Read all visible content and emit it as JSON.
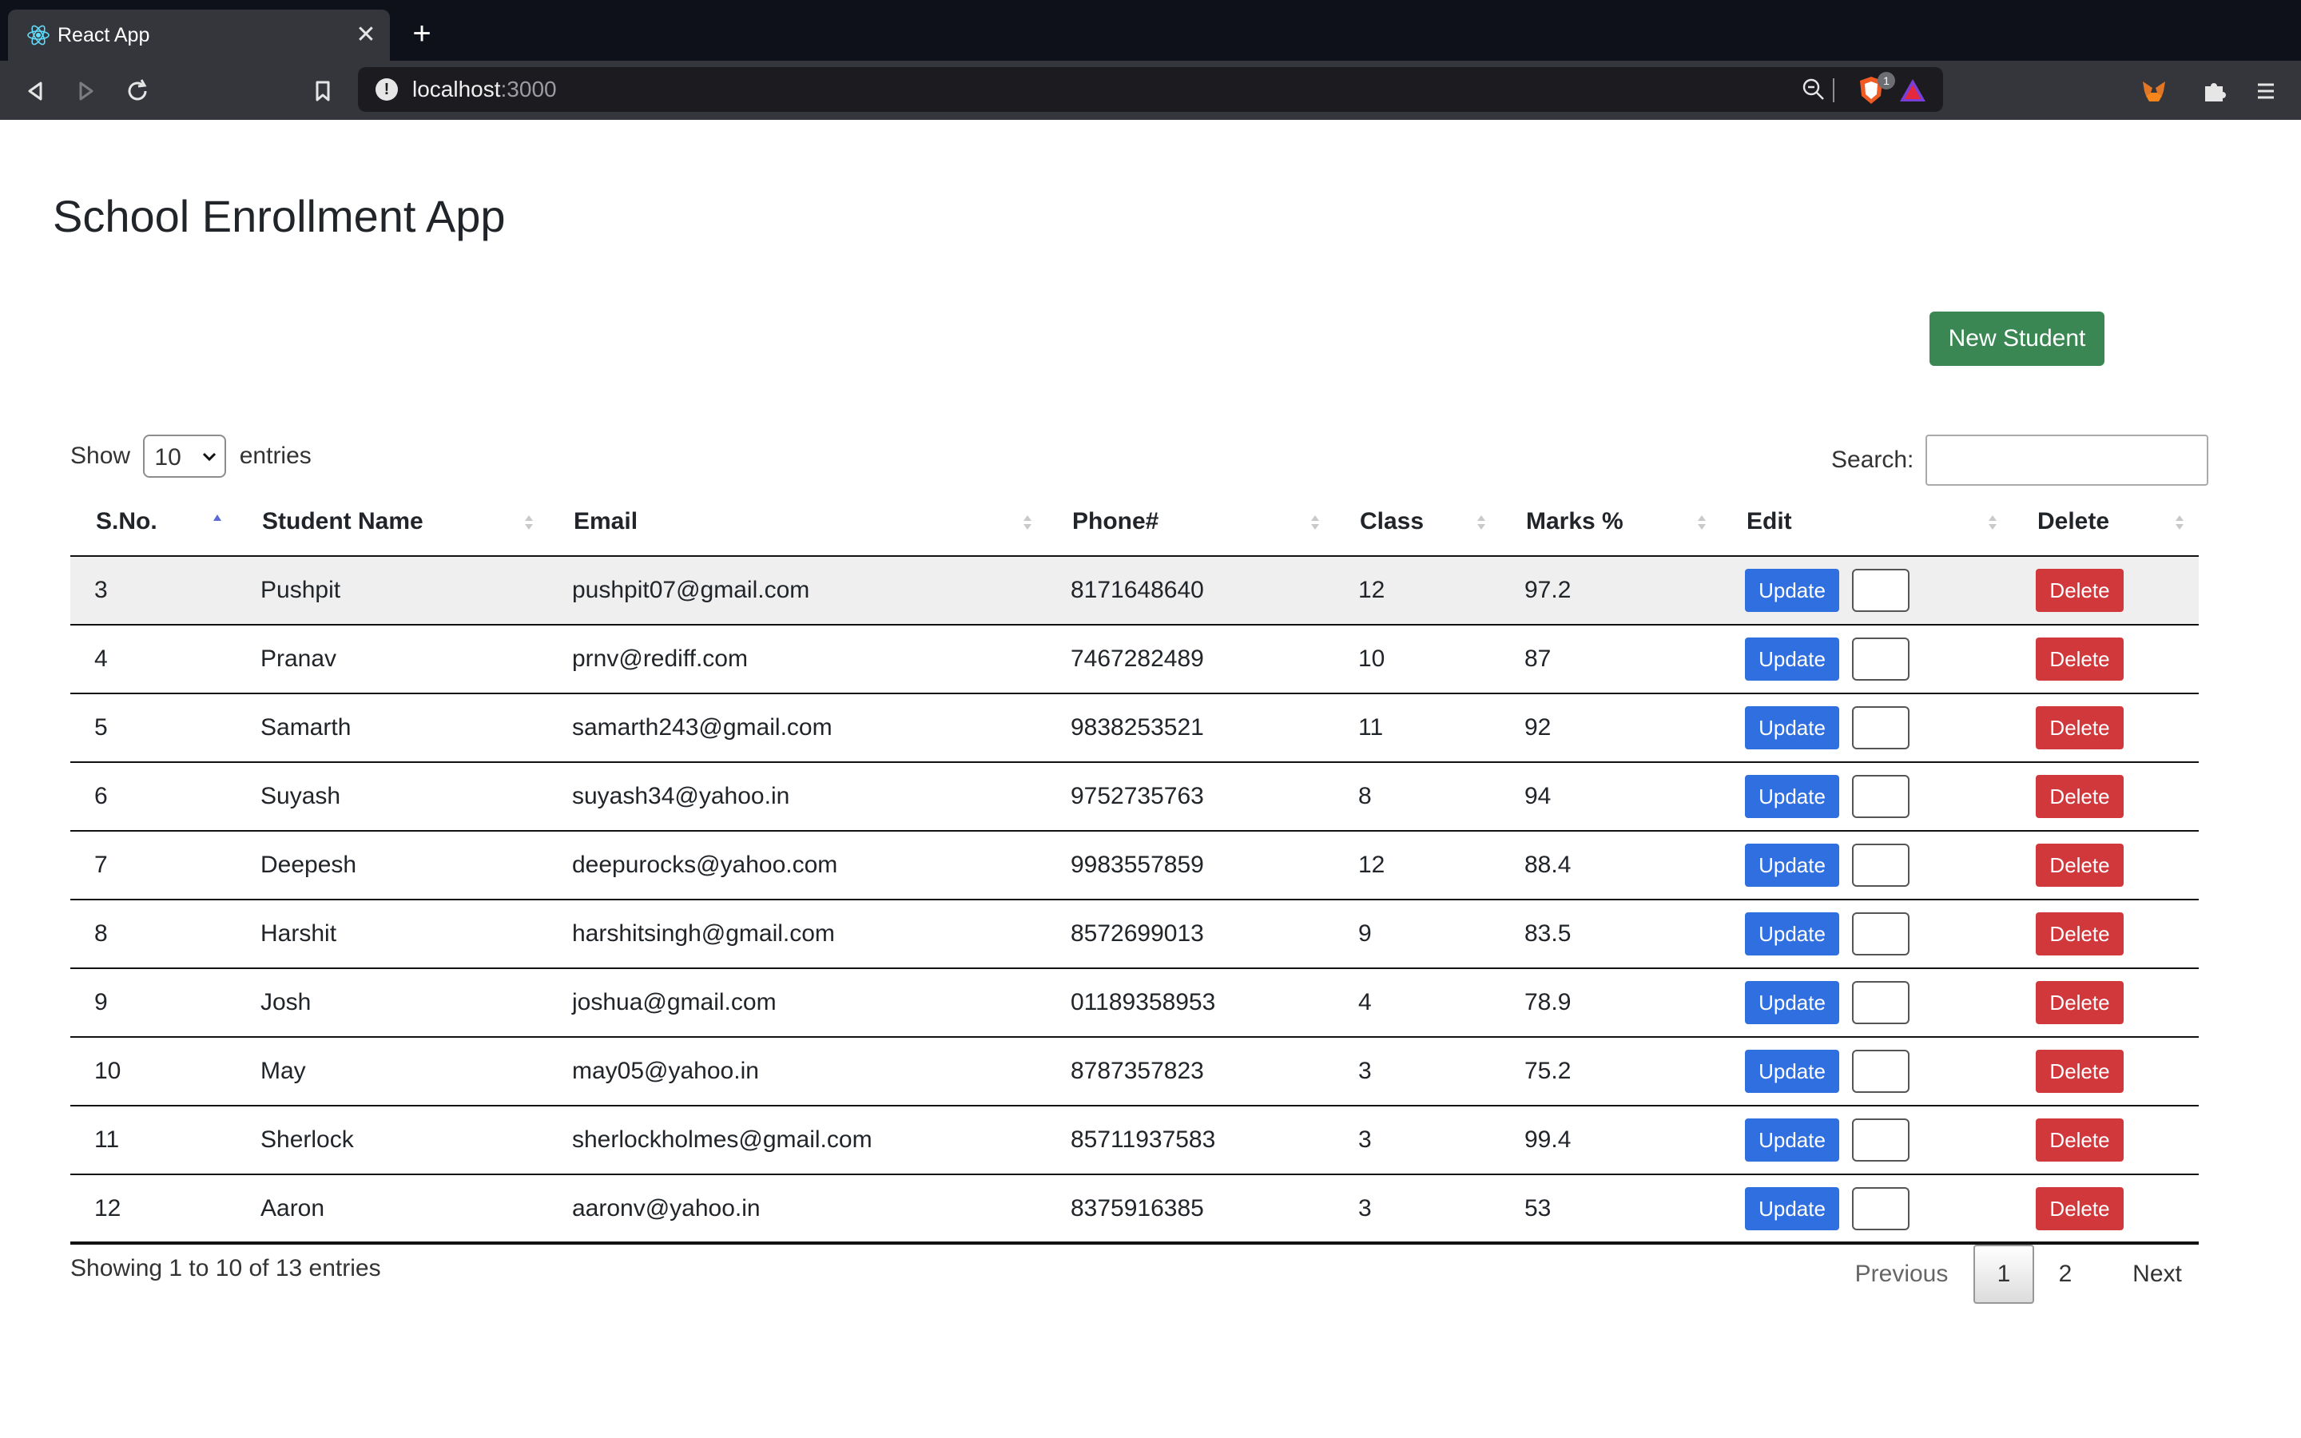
{
  "browser": {
    "tab_title": "React App",
    "url_host": "localhost",
    "url_port": ":3000"
  },
  "app": {
    "title": "School Enrollment App",
    "new_student_label": "New Student"
  },
  "table_controls": {
    "show_label": "Show",
    "entries_label": "entries",
    "length_value": "10",
    "search_label": "Search:",
    "search_value": ""
  },
  "table": {
    "columns": [
      "S.No.",
      "Student Name",
      "Email",
      "Phone#",
      "Class",
      "Marks %",
      "Edit",
      "Delete"
    ],
    "sorted_column": "S.No.",
    "sort_direction": "ascending",
    "update_label": "Update",
    "delete_label": "Delete",
    "rows": [
      {
        "sno": "3",
        "name": "Pushpit",
        "email": "pushpit07@gmail.com",
        "phone": "8171648640",
        "class": "12",
        "marks": "97.2"
      },
      {
        "sno": "4",
        "name": "Pranav",
        "email": "prnv@rediff.com",
        "phone": "7467282489",
        "class": "10",
        "marks": "87"
      },
      {
        "sno": "5",
        "name": "Samarth",
        "email": "samarth243@gmail.com",
        "phone": "9838253521",
        "class": "11",
        "marks": "92"
      },
      {
        "sno": "6",
        "name": "Suyash",
        "email": "suyash34@yahoo.in",
        "phone": "9752735763",
        "class": "8",
        "marks": "94"
      },
      {
        "sno": "7",
        "name": "Deepesh",
        "email": "deepurocks@yahoo.com",
        "phone": "9983557859",
        "class": "12",
        "marks": "88.4"
      },
      {
        "sno": "8",
        "name": "Harshit",
        "email": "harshitsingh@gmail.com",
        "phone": "8572699013",
        "class": "9",
        "marks": "83.5"
      },
      {
        "sno": "9",
        "name": "Josh",
        "email": "joshua@gmail.com",
        "phone": "01189358953",
        "class": "4",
        "marks": "78.9"
      },
      {
        "sno": "10",
        "name": "May",
        "email": "may05@yahoo.in",
        "phone": "8787357823",
        "class": "3",
        "marks": "75.2"
      },
      {
        "sno": "11",
        "name": "Sherlock",
        "email": "sherlockholmes@gmail.com",
        "phone": "85711937583",
        "class": "3",
        "marks": "99.4"
      },
      {
        "sno": "12",
        "name": "Aaron",
        "email": "aaronv@yahoo.in",
        "phone": "8375916385",
        "class": "3",
        "marks": "53"
      }
    ]
  },
  "footer": {
    "info": "Showing 1 to 10 of 13 entries",
    "previous": "Previous",
    "pages": [
      "1",
      "2"
    ],
    "current_page": "1",
    "next": "Next"
  },
  "colors": {
    "new_student": "#3a8754",
    "update": "#2f6fdf",
    "delete": "#d0383c"
  }
}
